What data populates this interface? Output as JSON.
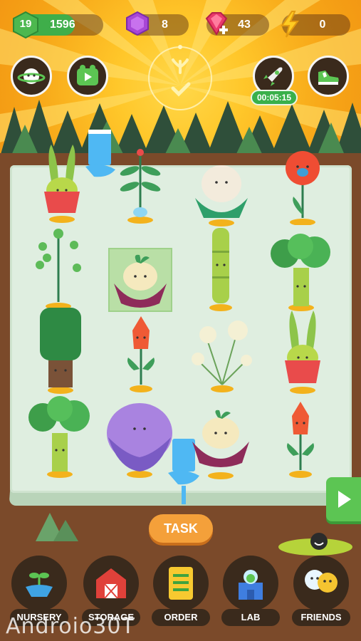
{
  "hud": {
    "level": "19",
    "xp": "1596",
    "xp_progress": 0.68,
    "gems": "8",
    "hearts": "43",
    "energy": "0"
  },
  "buttons": {
    "timer": "00:05:15"
  },
  "task_label": "TASK",
  "nav": [
    {
      "label": "NURSERY"
    },
    {
      "label": "STORAGE"
    },
    {
      "label": "ORDER"
    },
    {
      "label": "LAB"
    },
    {
      "label": "FRIENDS"
    }
  ],
  "watermark": "Androio30T",
  "colors": {
    "sky": "#ffc72a",
    "board": "#dfeee0",
    "soil": "#7b4a2a",
    "accent_green": "#3fae4a",
    "task_orange": "#f4a03a"
  }
}
